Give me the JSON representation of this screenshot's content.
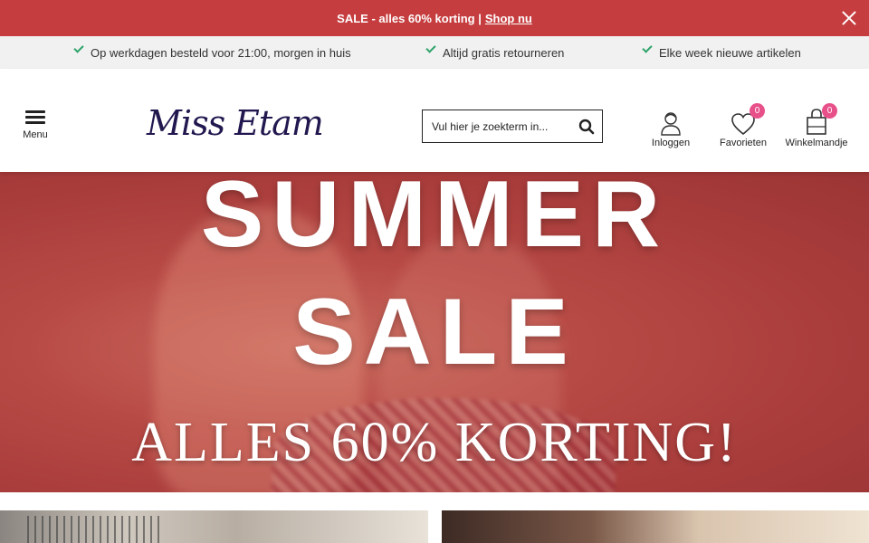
{
  "promo": {
    "text": "SALE -  alles 60% korting |",
    "link": "Shop nu"
  },
  "usp": [
    "Op werkdagen besteld voor 21:00, morgen in huis",
    "Altijd gratis retourneren",
    "Elke week nieuwe artikelen"
  ],
  "header": {
    "menu_label": "Menu",
    "logo_text": "Miss Etam",
    "search_placeholder": "Vul hier je zoekterm in...",
    "login_label": "Inloggen",
    "favorites_label": "Favorieten",
    "favorites_count": "0",
    "cart_label": "Winkelmandje",
    "cart_count": "0"
  },
  "hero": {
    "line1": "SUMMER",
    "line2": "SALE",
    "line3": "ALLES 60% KORTING!"
  },
  "colors": {
    "promo_bg": "#c63d3f",
    "brand": "#22184f",
    "badge": "#e8508a",
    "check": "#2ea36b"
  },
  "icons": {
    "close": "close-icon",
    "check": "check-icon",
    "menu": "hamburger-icon",
    "search": "search-icon",
    "user": "user-icon",
    "heart": "heart-icon",
    "bag": "shopping-bag-icon"
  }
}
